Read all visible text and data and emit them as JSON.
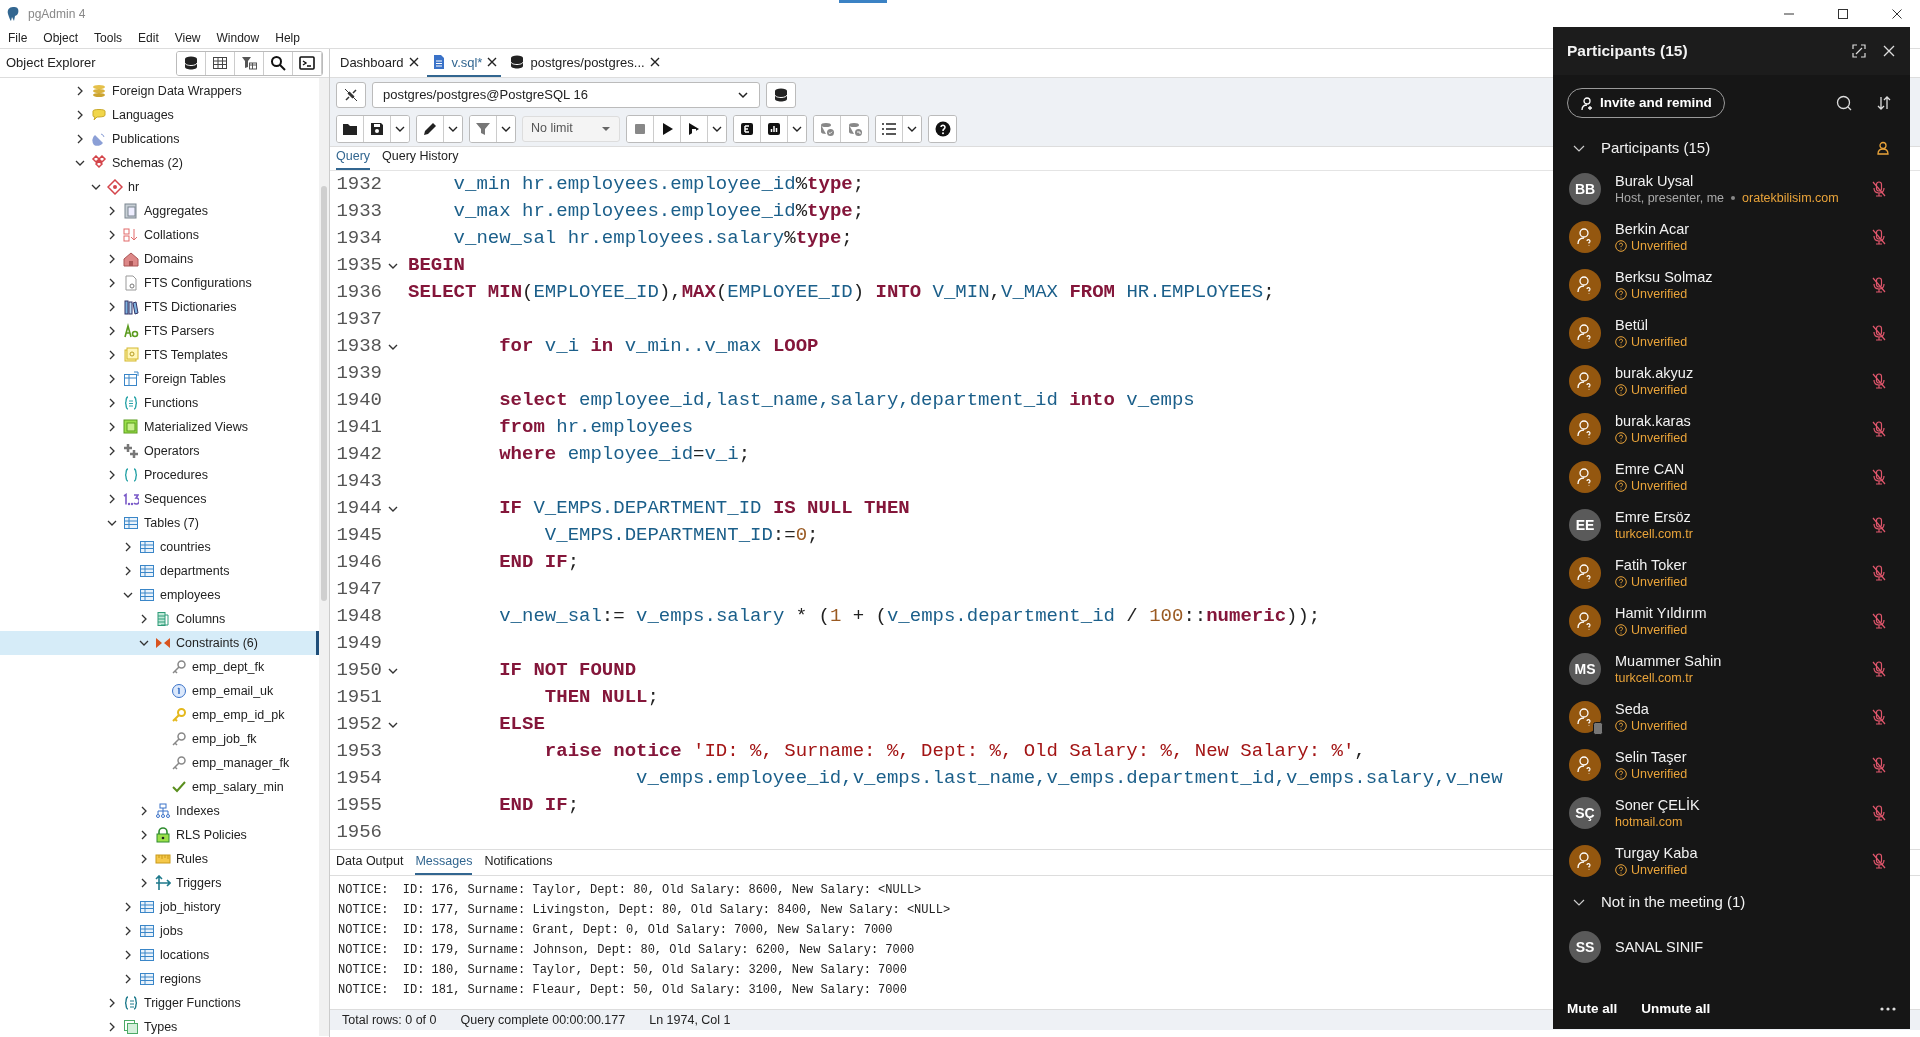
{
  "window": {
    "title": "pgAdmin 4"
  },
  "menu": [
    "File",
    "Object",
    "Tools",
    "Edit",
    "View",
    "Window",
    "Help"
  ],
  "object_explorer": {
    "title": "Object Explorer",
    "tree": [
      {
        "label": "Foreign Data Wrappers",
        "kind": "fdw",
        "expanded": false,
        "selected": false
      },
      {
        "label": "Languages",
        "kind": "language",
        "expanded": false,
        "selected": false
      },
      {
        "label": "Publications",
        "kind": "publication",
        "expanded": false,
        "selected": false
      },
      {
        "label": "Schemas (2)",
        "kind": "schemas",
        "expanded": true,
        "selected": false,
        "children": [
          {
            "label": "hr",
            "kind": "schema",
            "expanded": true,
            "selected": false,
            "children": [
              {
                "label": "Aggregates",
                "kind": "aggregate",
                "expanded": false,
                "selected": false
              },
              {
                "label": "Collations",
                "kind": "collation",
                "expanded": false,
                "selected": false
              },
              {
                "label": "Domains",
                "kind": "domain",
                "expanded": false,
                "selected": false
              },
              {
                "label": "FTS Configurations",
                "kind": "fts_config",
                "expanded": false,
                "selected": false
              },
              {
                "label": "FTS Dictionaries",
                "kind": "fts_dict",
                "expanded": false,
                "selected": false
              },
              {
                "label": "FTS Parsers",
                "kind": "fts_parser",
                "expanded": false,
                "selected": false
              },
              {
                "label": "FTS Templates",
                "kind": "fts_template",
                "expanded": false,
                "selected": false
              },
              {
                "label": "Foreign Tables",
                "kind": "foreign_table",
                "expanded": false,
                "selected": false
              },
              {
                "label": "Functions",
                "kind": "function",
                "expanded": false,
                "selected": false
              },
              {
                "label": "Materialized Views",
                "kind": "matview",
                "expanded": false,
                "selected": false
              },
              {
                "label": "Operators",
                "kind": "operator",
                "expanded": false,
                "selected": false
              },
              {
                "label": "Procedures",
                "kind": "procedure",
                "expanded": false,
                "selected": false
              },
              {
                "label": "Sequences",
                "kind": "sequence",
                "expanded": false,
                "selected": false
              },
              {
                "label": "Tables (7)",
                "kind": "table",
                "expanded": true,
                "selected": false,
                "children": [
                  {
                    "label": "countries",
                    "kind": "table",
                    "expanded": false,
                    "selected": false
                  },
                  {
                    "label": "departments",
                    "kind": "table",
                    "expanded": false,
                    "selected": false
                  },
                  {
                    "label": "employees",
                    "kind": "table",
                    "expanded": true,
                    "selected": false,
                    "children": [
                      {
                        "label": "Columns",
                        "kind": "columns",
                        "expanded": false,
                        "selected": false
                      },
                      {
                        "label": "Constraints (6)",
                        "kind": "constraints",
                        "expanded": true,
                        "selected": true,
                        "children": [
                          {
                            "label": "emp_dept_fk",
                            "kind": "foreign_key",
                            "selected": false
                          },
                          {
                            "label": "emp_email_uk",
                            "kind": "unique",
                            "selected": false
                          },
                          {
                            "label": "emp_emp_id_pk",
                            "kind": "primary_key",
                            "selected": false
                          },
                          {
                            "label": "emp_job_fk",
                            "kind": "foreign_key",
                            "selected": false
                          },
                          {
                            "label": "emp_manager_fk",
                            "kind": "foreign_key",
                            "selected": false
                          },
                          {
                            "label": "emp_salary_min",
                            "kind": "check",
                            "selected": false
                          }
                        ]
                      },
                      {
                        "label": "Indexes",
                        "kind": "index",
                        "expanded": false,
                        "selected": false
                      },
                      {
                        "label": "RLS Policies",
                        "kind": "rls",
                        "expanded": false,
                        "selected": false
                      },
                      {
                        "label": "Rules",
                        "kind": "rule",
                        "expanded": false,
                        "selected": false
                      },
                      {
                        "label": "Triggers",
                        "kind": "trigger",
                        "expanded": false,
                        "selected": false
                      }
                    ]
                  },
                  {
                    "label": "job_history",
                    "kind": "table",
                    "expanded": false,
                    "selected": false
                  },
                  {
                    "label": "jobs",
                    "kind": "table",
                    "expanded": false,
                    "selected": false
                  },
                  {
                    "label": "locations",
                    "kind": "table",
                    "expanded": false,
                    "selected": false
                  },
                  {
                    "label": "regions",
                    "kind": "table",
                    "expanded": false,
                    "selected": false
                  }
                ]
              },
              {
                "label": "Trigger Functions",
                "kind": "trigger_function",
                "expanded": false,
                "selected": false
              },
              {
                "label": "Types",
                "kind": "type",
                "expanded": false,
                "selected": false
              }
            ]
          }
        ]
      }
    ]
  },
  "editor_tabs": [
    {
      "label": "Dashboard",
      "kind": "dashboard",
      "selected": false
    },
    {
      "label": "v.sql*",
      "kind": "file",
      "selected": true
    },
    {
      "label": "postgres/postgres...",
      "kind": "database",
      "selected": false
    }
  ],
  "connection": {
    "value": "postgres/postgres@PostgreSQL 16"
  },
  "toolbar": {
    "row_limit": "No limit"
  },
  "query_tabs": [
    {
      "label": "Query",
      "selected": true
    },
    {
      "label": "Query History",
      "selected": false
    }
  ],
  "code_lines": [
    {
      "number": "1932",
      "foldable": false,
      "tokens": [
        {
          "kind": "ident",
          "text": "    v_min "
        },
        {
          "kind": "ident",
          "text": "hr.employees.employee_id"
        },
        {
          "kind": "plain",
          "text": "%"
        },
        {
          "kind": "keyword",
          "text": "type"
        },
        {
          "kind": "plain",
          "text": ";"
        }
      ]
    },
    {
      "number": "1933",
      "foldable": false,
      "tokens": [
        {
          "kind": "ident",
          "text": "    v_max "
        },
        {
          "kind": "ident",
          "text": "hr.employees.employee_id"
        },
        {
          "kind": "plain",
          "text": "%"
        },
        {
          "kind": "keyword",
          "text": "type"
        },
        {
          "kind": "plain",
          "text": ";"
        }
      ]
    },
    {
      "number": "1934",
      "foldable": false,
      "tokens": [
        {
          "kind": "ident",
          "text": "    v_new_sal "
        },
        {
          "kind": "ident",
          "text": "hr.employees.salary"
        },
        {
          "kind": "plain",
          "text": "%"
        },
        {
          "kind": "keyword",
          "text": "type"
        },
        {
          "kind": "plain",
          "text": ";"
        }
      ]
    },
    {
      "number": "1935",
      "foldable": true,
      "tokens": [
        {
          "kind": "keyword",
          "text": "BEGIN"
        }
      ]
    },
    {
      "number": "1936",
      "foldable": false,
      "tokens": [
        {
          "kind": "keyword",
          "text": "SELECT "
        },
        {
          "kind": "keyword",
          "text": "MIN"
        },
        {
          "kind": "plain",
          "text": "("
        },
        {
          "kind": "ident",
          "text": "EMPLOYEE_ID"
        },
        {
          "kind": "plain",
          "text": "),"
        },
        {
          "kind": "keyword",
          "text": "MAX"
        },
        {
          "kind": "plain",
          "text": "("
        },
        {
          "kind": "ident",
          "text": "EMPLOYEE_ID"
        },
        {
          "kind": "plain",
          "text": ") "
        },
        {
          "kind": "keyword",
          "text": "INTO "
        },
        {
          "kind": "ident",
          "text": "V_MIN"
        },
        {
          "kind": "plain",
          "text": ","
        },
        {
          "kind": "ident",
          "text": "V_MAX "
        },
        {
          "kind": "keyword",
          "text": "FROM "
        },
        {
          "kind": "ident",
          "text": "HR.EMPLOYEES"
        },
        {
          "kind": "plain",
          "text": ";"
        }
      ]
    },
    {
      "number": "1937",
      "foldable": false
    },
    {
      "number": "1938",
      "foldable": true,
      "tokens": [
        {
          "kind": "keyword",
          "text": "        for "
        },
        {
          "kind": "ident",
          "text": "v_i "
        },
        {
          "kind": "keyword",
          "text": "in "
        },
        {
          "kind": "ident",
          "text": "v_min..v_max "
        },
        {
          "kind": "keyword",
          "text": "LOOP"
        }
      ]
    },
    {
      "number": "1939",
      "foldable": false
    },
    {
      "number": "1940",
      "foldable": false,
      "tokens": [
        {
          "kind": "keyword",
          "text": "        select "
        },
        {
          "kind": "ident",
          "text": "employee_id,last_name,salary,department_id "
        },
        {
          "kind": "keyword",
          "text": "into "
        },
        {
          "kind": "ident",
          "text": "v_emps"
        }
      ]
    },
    {
      "number": "1941",
      "foldable": false,
      "tokens": [
        {
          "kind": "keyword",
          "text": "        from "
        },
        {
          "kind": "ident",
          "text": "hr.employees"
        }
      ]
    },
    {
      "number": "1942",
      "foldable": false,
      "tokens": [
        {
          "kind": "keyword",
          "text": "        where "
        },
        {
          "kind": "ident",
          "text": "employee_id"
        },
        {
          "kind": "plain",
          "text": "="
        },
        {
          "kind": "ident",
          "text": "v_i"
        },
        {
          "kind": "plain",
          "text": ";"
        }
      ]
    },
    {
      "number": "1943",
      "foldable": false
    },
    {
      "number": "1944",
      "foldable": true,
      "tokens": [
        {
          "kind": "keyword",
          "text": "        IF "
        },
        {
          "kind": "ident",
          "text": "V_EMPS.DEPARTMENT_ID "
        },
        {
          "kind": "keyword",
          "text": "IS NULL THEN"
        }
      ]
    },
    {
      "number": "1945",
      "foldable": false,
      "tokens": [
        {
          "kind": "ident",
          "text": "            V_EMPS.DEPARTMENT_ID"
        },
        {
          "kind": "plain",
          "text": ":="
        },
        {
          "kind": "number",
          "text": "0"
        },
        {
          "kind": "plain",
          "text": ";"
        }
      ]
    },
    {
      "number": "1946",
      "foldable": false,
      "tokens": [
        {
          "kind": "keyword",
          "text": "        END IF"
        },
        {
          "kind": "plain",
          "text": ";"
        }
      ]
    },
    {
      "number": "1947",
      "foldable": false
    },
    {
      "number": "1948",
      "foldable": false,
      "tokens": [
        {
          "kind": "ident",
          "text": "        v_new_sal"
        },
        {
          "kind": "plain",
          "text": ":= "
        },
        {
          "kind": "ident",
          "text": "v_emps.salary"
        },
        {
          "kind": "plain",
          "text": " * ("
        },
        {
          "kind": "number",
          "text": "1"
        },
        {
          "kind": "plain",
          "text": " + ("
        },
        {
          "kind": "ident",
          "text": "v_emps.department_id"
        },
        {
          "kind": "plain",
          "text": " / "
        },
        {
          "kind": "number",
          "text": "100"
        },
        {
          "kind": "plain",
          "text": "::"
        },
        {
          "kind": "keyword",
          "text": "numeric"
        },
        {
          "kind": "plain",
          "text": "));"
        }
      ]
    },
    {
      "number": "1949",
      "foldable": false
    },
    {
      "number": "1950",
      "foldable": true,
      "tokens": [
        {
          "kind": "keyword",
          "text": "        IF NOT FOUND"
        }
      ]
    },
    {
      "number": "1951",
      "foldable": false,
      "tokens": [
        {
          "kind": "keyword",
          "text": "            THEN NULL"
        },
        {
          "kind": "plain",
          "text": ";"
        }
      ]
    },
    {
      "number": "1952",
      "foldable": true,
      "tokens": [
        {
          "kind": "keyword",
          "text": "        ELSE"
        }
      ]
    },
    {
      "number": "1953",
      "foldable": false,
      "tokens": [
        {
          "kind": "keyword",
          "text": "            raise notice "
        },
        {
          "kind": "string",
          "text": "'ID: %, Surname: %, Dept: %, Old Salary: %, New Salary: %'"
        },
        {
          "kind": "plain",
          "text": ","
        }
      ]
    },
    {
      "number": "1954",
      "foldable": false,
      "tokens": [
        {
          "kind": "ident",
          "text": "                    v_emps.employee_id,v_emps.last_name,v_emps.department_id,v_emps.salary,v_new"
        }
      ]
    },
    {
      "number": "1955",
      "foldable": false,
      "tokens": [
        {
          "kind": "keyword",
          "text": "        END IF"
        },
        {
          "kind": "plain",
          "text": ";"
        }
      ]
    },
    {
      "number": "1956",
      "foldable": false
    }
  ],
  "result_tabs": [
    {
      "label": "Data Output",
      "selected": false
    },
    {
      "label": "Messages",
      "selected": true
    },
    {
      "label": "Notifications",
      "selected": false
    }
  ],
  "messages": [
    "NOTICE:  ID: 176, Surname: Taylor, Dept: 80, Old Salary: 8600, New Salary: <NULL>",
    "NOTICE:  ID: 177, Surname: Livingston, Dept: 80, Old Salary: 8400, New Salary: <NULL>",
    "NOTICE:  ID: 178, Surname: Grant, Dept: 0, Old Salary: 7000, New Salary: 7000",
    "NOTICE:  ID: 179, Surname: Johnson, Dept: 80, Old Salary: 6200, New Salary: 7000",
    "NOTICE:  ID: 180, Surname: Taylor, Dept: 50, Old Salary: 3200, New Salary: 7000",
    "NOTICE:  ID: 181, Surname: Fleaur, Dept: 50, Old Salary: 3100, New Salary: 7000"
  ],
  "status_bar": [
    "Total rows: 0 of 0",
    "Query complete 00:00:00.177",
    "Ln 1974, Col 1"
  ],
  "participants_panel": {
    "title": "Participants (15)",
    "invite_label": "Invite and remind",
    "section_title": "Participants (15)",
    "participants": [
      {
        "name": "Burak Uysal",
        "avatar": {
          "kind": "initials",
          "initials": "BB"
        },
        "role": "Host, presenter, me",
        "detail": {
          "kind": "domain",
          "text": "oratekbilisim.com"
        },
        "muted": true,
        "mobile": false
      },
      {
        "name": "Berkin Acar",
        "avatar": {
          "kind": "guest"
        },
        "detail": {
          "kind": "unverified",
          "text": "Unverified"
        },
        "muted": true,
        "mobile": false
      },
      {
        "name": "Berksu Solmaz",
        "avatar": {
          "kind": "guest"
        },
        "detail": {
          "kind": "unverified",
          "text": "Unverified"
        },
        "muted": true,
        "mobile": false
      },
      {
        "name": "Betül",
        "avatar": {
          "kind": "guest"
        },
        "detail": {
          "kind": "unverified",
          "text": "Unverified"
        },
        "muted": true,
        "mobile": false
      },
      {
        "name": "burak.akyuz",
        "avatar": {
          "kind": "guest"
        },
        "detail": {
          "kind": "unverified",
          "text": "Unverified"
        },
        "muted": true,
        "mobile": false
      },
      {
        "name": "burak.karas",
        "avatar": {
          "kind": "guest"
        },
        "detail": {
          "kind": "unverified",
          "text": "Unverified"
        },
        "muted": true,
        "mobile": false
      },
      {
        "name": "Emre CAN",
        "avatar": {
          "kind": "guest"
        },
        "detail": {
          "kind": "unverified",
          "text": "Unverified"
        },
        "muted": true,
        "mobile": false
      },
      {
        "name": "Emre Ersöz",
        "avatar": {
          "kind": "initials",
          "initials": "EE"
        },
        "detail": {
          "kind": "domain",
          "text": "turkcell.com.tr"
        },
        "muted": true,
        "mobile": false
      },
      {
        "name": "Fatih Toker",
        "avatar": {
          "kind": "guest"
        },
        "detail": {
          "kind": "unverified",
          "text": "Unverified"
        },
        "muted": true,
        "mobile": false
      },
      {
        "name": "Hamit Yıldırım",
        "avatar": {
          "kind": "guest"
        },
        "detail": {
          "kind": "unverified",
          "text": "Unverified"
        },
        "muted": true,
        "mobile": false
      },
      {
        "name": "Muammer Sahin",
        "avatar": {
          "kind": "initials",
          "initials": "MS"
        },
        "detail": {
          "kind": "domain",
          "text": "turkcell.com.tr"
        },
        "muted": true,
        "mobile": false
      },
      {
        "name": "Seda",
        "avatar": {
          "kind": "guest"
        },
        "detail": {
          "kind": "unverified",
          "text": "Unverified"
        },
        "muted": true,
        "mobile": true
      },
      {
        "name": "Selin Taşer",
        "avatar": {
          "kind": "guest"
        },
        "detail": {
          "kind": "unverified",
          "text": "Unverified"
        },
        "muted": true,
        "mobile": false
      },
      {
        "name": "Soner ÇELİK",
        "avatar": {
          "kind": "initials",
          "initials": "SÇ"
        },
        "detail": {
          "kind": "domain",
          "text": "hotmail.com"
        },
        "muted": true,
        "mobile": false
      },
      {
        "name": "Turgay Kaba",
        "avatar": {
          "kind": "guest"
        },
        "detail": {
          "kind": "unverified",
          "text": "Unverified"
        },
        "muted": true,
        "mobile": false
      }
    ],
    "absent_title": "Not in the meeting (1)",
    "absent": [
      {
        "name": "SANAL SINIF",
        "avatar": {
          "kind": "initials",
          "initials": "SS"
        }
      }
    ],
    "footer_buttons": [
      "Mute all",
      "Unmute all"
    ]
  }
}
